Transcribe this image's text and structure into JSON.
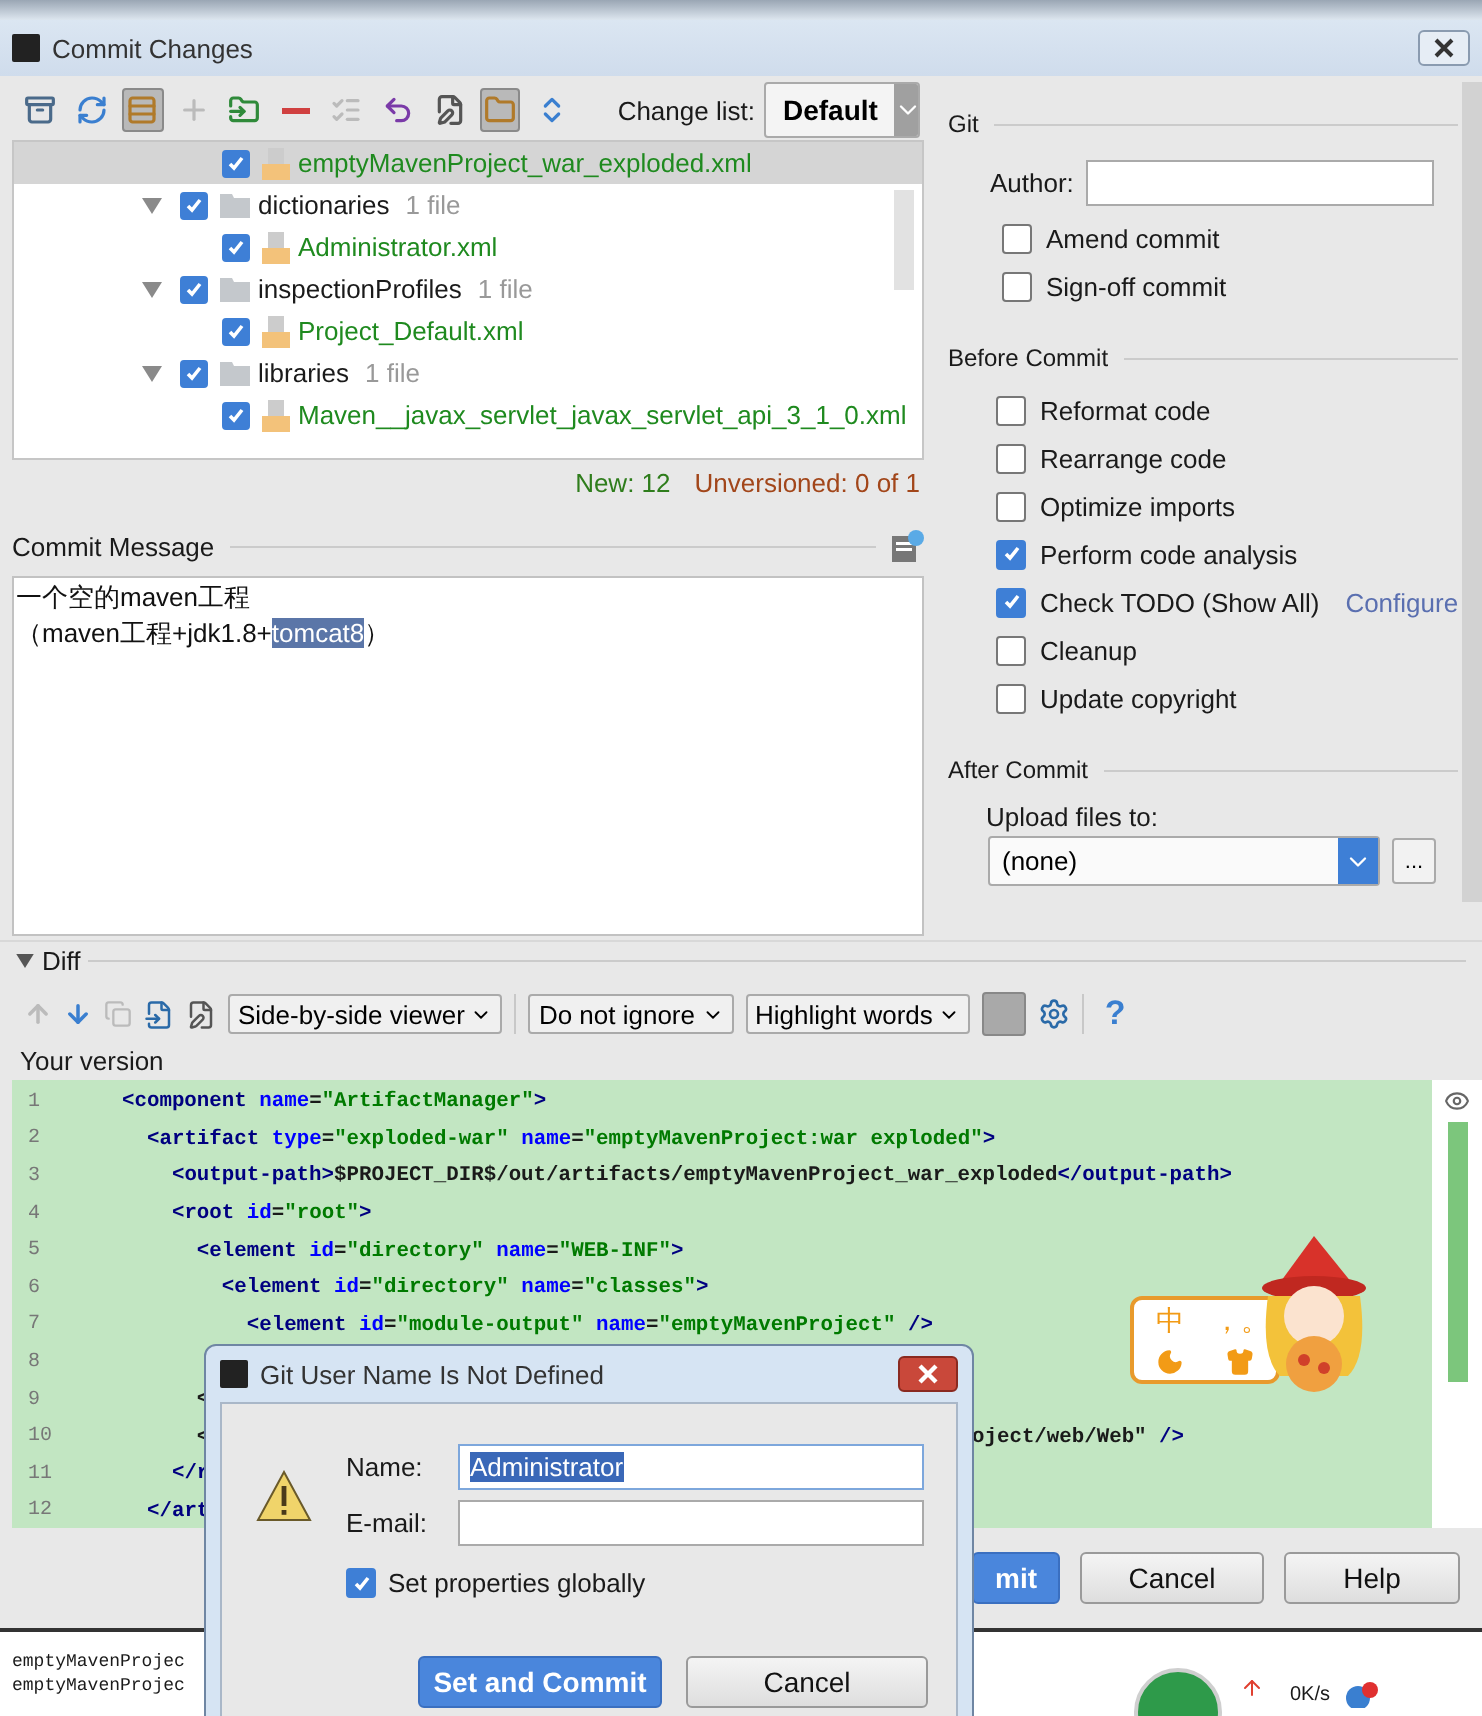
{
  "window": {
    "title": "Commit Changes"
  },
  "toolbar": [
    {
      "kind": "shelve",
      "selected": false,
      "disabled": false
    },
    {
      "kind": "refresh",
      "selected": false,
      "disabled": false
    },
    {
      "kind": "group",
      "selected": true,
      "disabled": false
    },
    {
      "kind": "add",
      "selected": false,
      "disabled": true
    },
    {
      "kind": "move",
      "selected": false,
      "disabled": false
    },
    {
      "kind": "remove",
      "selected": false,
      "disabled": false
    },
    {
      "kind": "list",
      "selected": false,
      "disabled": true
    },
    {
      "kind": "revert",
      "selected": false,
      "disabled": false
    },
    {
      "kind": "edit",
      "selected": false,
      "disabled": false
    },
    {
      "kind": "folder",
      "selected": true,
      "disabled": false
    },
    {
      "kind": "expand",
      "selected": false,
      "disabled": false
    }
  ],
  "change_list": {
    "label": "Change list:",
    "value": "Default"
  },
  "tree": [
    {
      "kind": "continued",
      "children": [
        {
          "kind": "file",
          "name": "emptyMavenProject_war_exploded.xml",
          "checked": true,
          "selected": true
        }
      ]
    },
    {
      "kind": "folder",
      "name": "dictionaries",
      "count": "1 file",
      "checked": true,
      "expanded": true,
      "selected": false,
      "children": [
        {
          "kind": "file",
          "name": "Administrator.xml",
          "checked": true,
          "selected": false
        }
      ]
    },
    {
      "kind": "folder",
      "name": "inspectionProfiles",
      "count": "1 file",
      "checked": true,
      "expanded": true,
      "selected": false,
      "children": [
        {
          "kind": "file",
          "name": "Project_Default.xml",
          "checked": true,
          "selected": false
        }
      ]
    },
    {
      "kind": "folder",
      "name": "libraries",
      "count": "1 file",
      "checked": true,
      "expanded": true,
      "selected": false,
      "children": [
        {
          "kind": "file",
          "name": "Maven__javax_servlet_javax_servlet_api_3_1_0.xml",
          "checked": true,
          "selected": false
        }
      ]
    }
  ],
  "summary": {
    "new": "New: 12",
    "unversioned": "Unversioned: 0 of 1"
  },
  "commit_message": {
    "label": "Commit Message",
    "lines": [
      [
        {
          "text": "一个空的maven工程",
          "selected": false
        }
      ],
      [
        {
          "text": "（maven工程+jdk1.8+",
          "selected": false
        },
        {
          "text": "tomcat8",
          "selected": true
        },
        {
          "text": "）",
          "selected": false
        }
      ]
    ]
  },
  "git": {
    "title": "Git",
    "author_label": "Author:",
    "options": [
      {
        "label": "Amend commit",
        "checked": false
      },
      {
        "label": "Sign-off commit",
        "checked": false
      }
    ]
  },
  "before_commit": {
    "title": "Before Commit",
    "options": [
      {
        "label": "Reformat code",
        "checked": false
      },
      {
        "label": "Rearrange code",
        "checked": false
      },
      {
        "label": "Optimize imports",
        "checked": false
      },
      {
        "label": "Perform code analysis",
        "checked": true
      },
      {
        "label": "Check TODO (Show All)",
        "checked": true,
        "link": "Configure"
      },
      {
        "label": "Cleanup",
        "checked": false
      },
      {
        "label": "Update copyright",
        "checked": false
      }
    ]
  },
  "after_commit": {
    "title": "After Commit",
    "upload_label": "Upload files to:",
    "upload_value": "(none)",
    "browse": "..."
  },
  "diff": {
    "title": "Diff",
    "expanded": true,
    "viewer": "Side-by-side viewer",
    "ignore": "Do not ignore",
    "highlight": "Highlight words",
    "help": "?",
    "version_label": "Your version",
    "lines": [
      {
        "number": "1",
        "text": "<component name=\"ArtifactManager\">"
      },
      {
        "number": "2",
        "text": "  <artifact type=\"exploded-war\" name=\"emptyMavenProject:war exploded\">"
      },
      {
        "number": "3",
        "text": "    <output-path>$PROJECT_DIR$/out/artifacts/emptyMavenProject_war_exploded</output-path>"
      },
      {
        "number": "4",
        "text": "    <root id=\"root\">"
      },
      {
        "number": "5",
        "text": "      <element id=\"directory\" name=\"WEB-INF\">"
      },
      {
        "number": "6",
        "text": "        <element id=\"directory\" name=\"classes\">"
      },
      {
        "number": "7",
        "text": "          <element id=\"module-output\" name=\"emptyMavenProject\" />"
      },
      {
        "number": "8"
      },
      {
        "number": "9",
        "text": "      <"
      },
      {
        "number": "10",
        "text": "      <",
        "tail": "oject/web/Web\" />"
      },
      {
        "number": "11",
        "text": "    </r"
      },
      {
        "number": "12",
        "text": "  </art"
      }
    ]
  },
  "ime": {
    "mode": "中",
    "punctuation": "，。"
  },
  "buttons": {
    "commit": "mit",
    "cancel": "Cancel",
    "help": "Help"
  },
  "dialog": {
    "title": "Git User Name Is Not Defined",
    "name_label": "Name:",
    "name_value": "Administrator",
    "email_label": "E-mail:",
    "global": {
      "label": "Set properties globally",
      "checked": true
    },
    "ok": "Set and Commit",
    "cancel": "Cancel"
  },
  "taskbar": {
    "items": [
      "emptyMavenProjec",
      "emptyMavenProjec"
    ],
    "speed": "0K/s"
  }
}
